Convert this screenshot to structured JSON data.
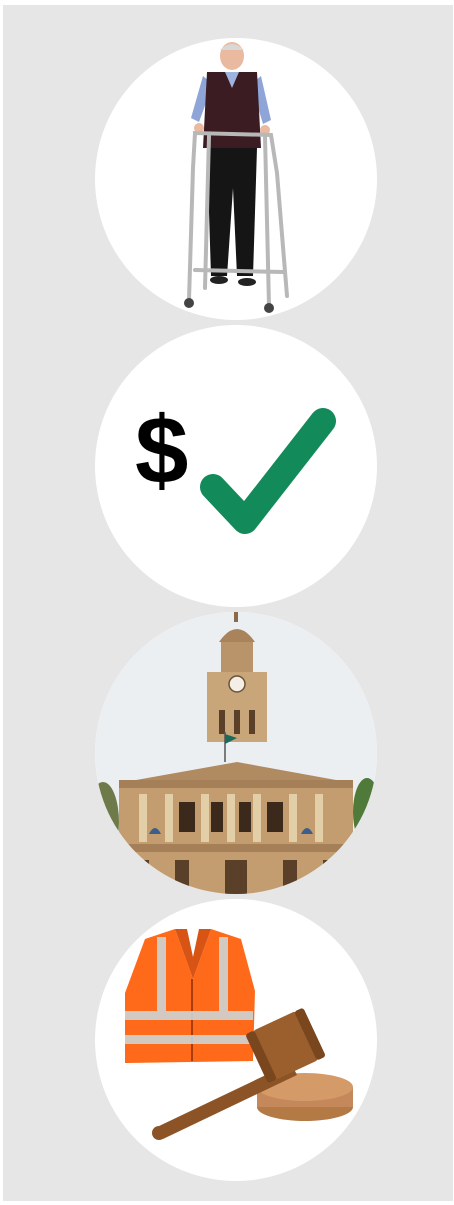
{
  "illustrations": [
    {
      "icon": "elderly-man-walking-frame-icon"
    },
    {
      "icon": "money-approved-icon",
      "symbol": "$",
      "check_color": "#128a5a"
    },
    {
      "icon": "town-hall-building-icon"
    },
    {
      "icon": "safety-vest-and-gavel-icon",
      "vest_color": "#ff6a1a"
    }
  ]
}
